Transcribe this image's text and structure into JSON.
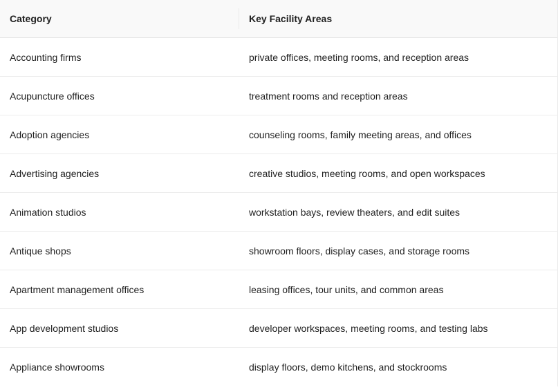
{
  "table": {
    "headers": [
      "Category",
      "Key Facility Areas"
    ],
    "rows": [
      [
        "Accounting firms",
        "private offices, meeting rooms, and reception areas"
      ],
      [
        "Acupuncture offices",
        "treatment rooms and reception areas"
      ],
      [
        "Adoption agencies",
        "counseling rooms, family meeting areas, and offices"
      ],
      [
        "Advertising agencies",
        "creative studios, meeting rooms, and open workspaces"
      ],
      [
        "Animation studios",
        "workstation bays, review theaters, and edit suites"
      ],
      [
        "Antique shops",
        "showroom floors, display cases, and storage rooms"
      ],
      [
        "Apartment management offices",
        "leasing offices, tour units, and common areas"
      ],
      [
        "App development studios",
        "developer workspaces, meeting rooms, and testing labs"
      ],
      [
        "Appliance showrooms",
        "display floors, demo kitchens, and stockrooms"
      ]
    ]
  }
}
